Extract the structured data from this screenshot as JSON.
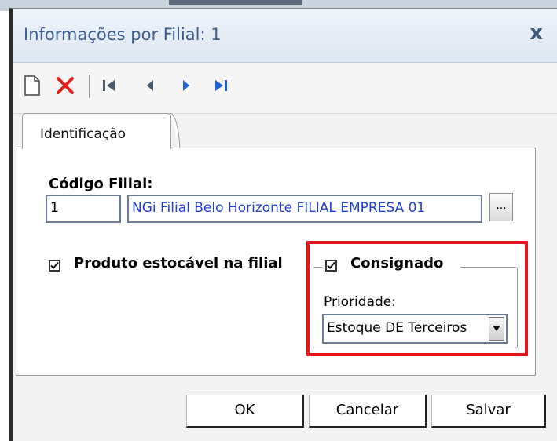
{
  "window": {
    "title": "Informações por Filial: 1",
    "close_label": "x"
  },
  "toolbar": {
    "icons": [
      "new-document-icon",
      "delete-icon",
      "first-record-icon",
      "previous-record-icon",
      "next-record-icon",
      "last-record-icon"
    ]
  },
  "tabs": [
    {
      "label": "Identificação",
      "active": true
    }
  ],
  "form": {
    "codigo_filial_label": "Código Filial:",
    "codigo_value": "1",
    "filial_description": "NGi Filial Belo Horizonte  FILIAL  EMPRESA 01",
    "lookup_label": "...",
    "produto_estocavel": {
      "label": "Produto estocável na filial",
      "checked": true
    },
    "consignado": {
      "label": "Consignado",
      "checked": true
    },
    "prioridade_label": "Prioridade:",
    "prioridade_value": "Estoque DE Terceiros"
  },
  "buttons": {
    "ok": "OK",
    "cancelar": "Cancelar",
    "salvar": "Salvar"
  },
  "colors": {
    "title_text": "#3d5f8f",
    "highlight": "#e3141c",
    "description_text": "#1f3fd6"
  }
}
